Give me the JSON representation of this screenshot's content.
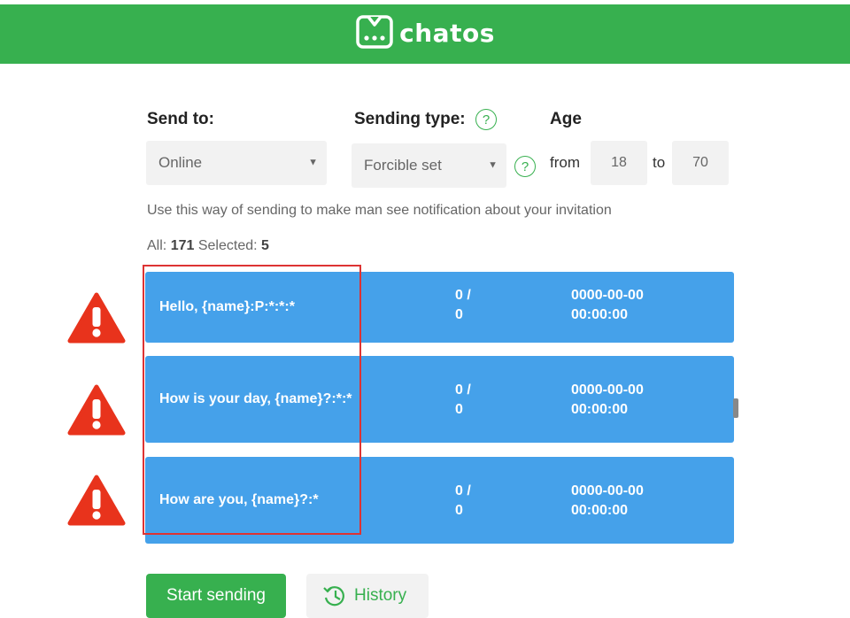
{
  "brand": {
    "name": "chatos",
    "color": "#37b04f",
    "icon": "chat-logo-icon"
  },
  "form": {
    "send_to_label": "Send to:",
    "send_to_value": "Online",
    "sending_type_label": "Sending type:",
    "sending_type_value": "Forcible set",
    "age_label": "Age",
    "from_label": "from",
    "age_from": "18",
    "to_label": "to",
    "age_to": "70",
    "hint": "Use this way of sending to make man see notification about your invitation"
  },
  "counts": {
    "all_label": "All:",
    "all_value": "171",
    "selected_label": "Selected:",
    "selected_value": "5"
  },
  "messages": [
    {
      "text": "Hello, {name}:P:*:*:*",
      "count_line1": "0 /",
      "count_line2": "0",
      "date": "0000-00-00",
      "time": "00:00:00"
    },
    {
      "text": "How is your day, {name}?:*:*",
      "count_line1": "0 /",
      "count_line2": "0",
      "date": "0000-00-00",
      "time": "00:00:00"
    },
    {
      "text": "How are you, {name}?:*",
      "count_line1": "0 /",
      "count_line2": "0",
      "date": "0000-00-00",
      "time": "00:00:00"
    }
  ],
  "buttons": {
    "start": "Start sending",
    "history": "History"
  },
  "colors": {
    "row": "#45a1ea",
    "warning": "#e8331c",
    "highlight": "#d33333"
  }
}
